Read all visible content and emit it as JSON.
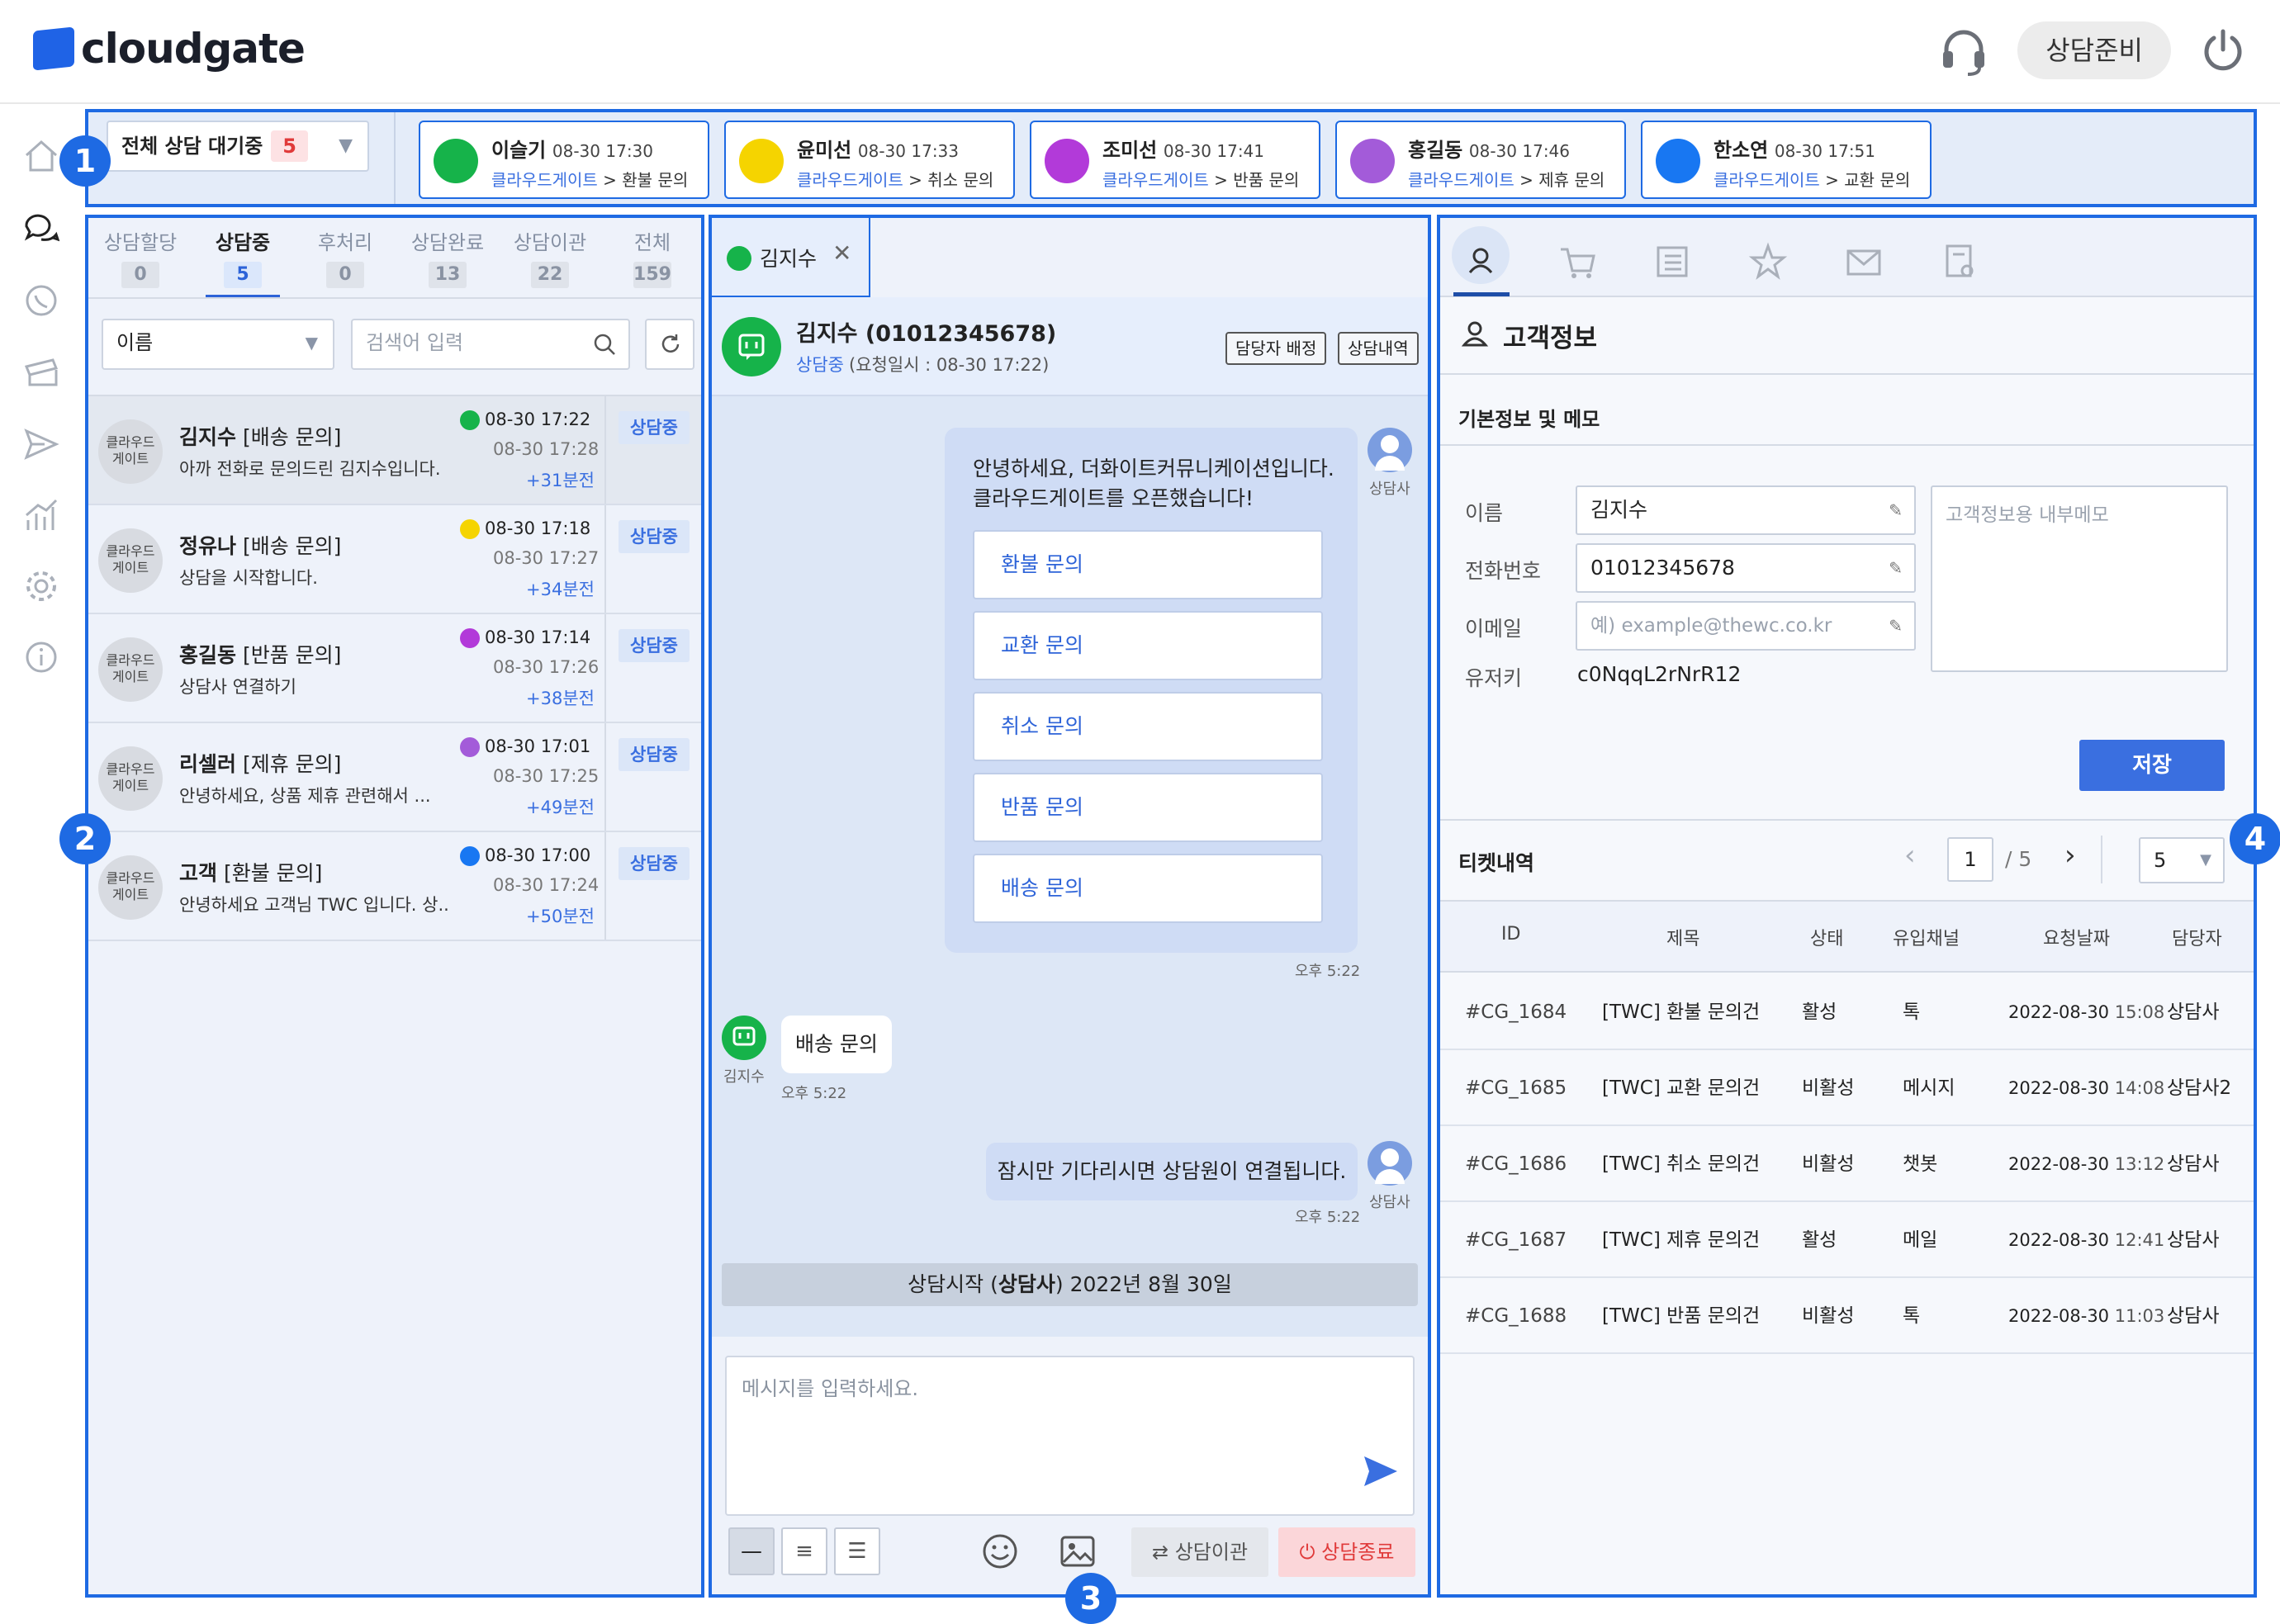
{
  "app": {
    "logo": "cloudgate",
    "status": "상담준비"
  },
  "icons": {
    "headset": "headset-icon",
    "power": "power-icon",
    "brand_color": "#1e6ae3"
  },
  "sidebar": [
    "home-icon",
    "chat-icon",
    "whatsapp-icon",
    "ticket-icon",
    "send-icon",
    "stats-icon",
    "gear-icon",
    "info-icon"
  ],
  "badges": {
    "b1": "1",
    "b2": "2",
    "b3": "3",
    "b4": "4"
  },
  "queue": {
    "filter_label": "전체 상담 대기중",
    "filter_count": "5",
    "cards": [
      {
        "name": "이슬기",
        "time": "08-30 17:30",
        "brand": "클라우드게이트",
        "topic": " > 환불 문의",
        "channel": "line",
        "color": "#16b34a"
      },
      {
        "name": "윤미선",
        "time": "08-30 17:33",
        "brand": "클라우드게이트",
        "topic": " > 취소 문의",
        "channel": "kakao",
        "color": "#f5d400"
      },
      {
        "name": "조미선",
        "time": "08-30 17:41",
        "brand": "클라우드게이트",
        "topic": " > 반품 문의",
        "channel": "bot",
        "color": "#b23ad9"
      },
      {
        "name": "홍길동",
        "time": "08-30 17:46",
        "brand": "클라우드게이트",
        "topic": " > 제휴 문의",
        "channel": "mail",
        "color": "#a35bd9"
      },
      {
        "name": "한소연",
        "time": "08-30 17:51",
        "brand": "클라우드게이트",
        "topic": " > 교환 문의",
        "channel": "messenger",
        "color": "#1877f2"
      }
    ]
  },
  "list": {
    "tabs": [
      {
        "label": "상담할당",
        "count": "0"
      },
      {
        "label": "상담중",
        "count": "5"
      },
      {
        "label": "후처리",
        "count": "0"
      },
      {
        "label": "상담완료",
        "count": "13"
      },
      {
        "label": "상담이관",
        "count": "22"
      },
      {
        "label": "전체",
        "count": "159"
      }
    ],
    "search_field": "이름",
    "search_placeholder": "검색어 입력",
    "avatar_text_1": "클라우드",
    "avatar_text_2": "게이트",
    "rows": [
      {
        "name": "김지수",
        "tag": " [배송 문의]",
        "msg": "아까 전화로 문의드린 김지수입니다.",
        "t1": "08-30 17:22",
        "t2": "08-30 17:28",
        "t3": "+31분전",
        "status": "상담중",
        "color": "#16b34a"
      },
      {
        "name": "정유나",
        "tag": " [배송 문의]",
        "msg": "상담을 시작합니다.",
        "t1": "08-30 17:18",
        "t2": "08-30 17:27",
        "t3": "+34분전",
        "status": "상담중",
        "color": "#f5d400"
      },
      {
        "name": "홍길동",
        "tag": " [반품 문의]",
        "msg": "상담사 연결하기",
        "t1": "08-30 17:14",
        "t2": "08-30 17:26",
        "t3": "+38분전",
        "status": "상담중",
        "color": "#b23ad9"
      },
      {
        "name": "리셀러",
        "tag": " [제휴 문의]",
        "msg": "안녕하세요, 상품 제휴 관련해서 ...",
        "t1": "08-30 17:01",
        "t2": "08-30 17:25",
        "t3": "+49분전",
        "status": "상담중",
        "color": "#a35bd9"
      },
      {
        "name": "고객",
        "tag": " [환불 문의]",
        "msg": "안녕하세요 고객님 TWC 입니다. 상..",
        "t1": "08-30 17:00",
        "t2": "08-30 17:24",
        "t3": "+50분전",
        "status": "상담중",
        "color": "#1877f2"
      }
    ]
  },
  "chat": {
    "tab_name": "김지수",
    "title": "김지수 (01012345678)",
    "sub_status": "상담중",
    "sub_time": " (요청일시 : 08-30 17:22)",
    "btn_assign": "담당자 배정",
    "btn_history": "상담내역",
    "greet_1": "안녕하세요, 더화이트커뮤니케이션입니다.",
    "greet_2": "클라우드게이트를 오픈했습니다!",
    "options": [
      "환불 문의",
      "교환 문의",
      "취소 문의",
      "반품 문의",
      "배송 문의"
    ],
    "agent_label": "상담사",
    "time": "오후 5:22",
    "user_msg": "배송 문의",
    "user_label": "김지수",
    "wait_msg": "잠시만 기다리시면 상담원이 연결됩니다.",
    "start_pre": "상담시작 (",
    "start_bold": "상담사",
    "start_post": ") 2022년 8월 30일",
    "input_placeholder": "메시지를 입력하세요.",
    "btn_transfer": "상담이관",
    "btn_end": "상담종료"
  },
  "customer": {
    "tab_icons": [
      "user-icon",
      "cart-icon",
      "list-icon",
      "star-icon",
      "mail-icon",
      "doc-search-icon"
    ],
    "title": "고객정보",
    "section": "기본정보 및 메모",
    "name_label": "이름",
    "name_value": "김지수",
    "phone_label": "전화번호",
    "phone_value": "01012345678",
    "email_label": "이메일",
    "email_placeholder": "예) example@thewc.co.kr",
    "userkey_label": "유저키",
    "userkey_value": "c0NqqL2rNrR12",
    "memo_placeholder": "고객정보용 내부메모",
    "save": "저장",
    "tickets_title": "티켓내역",
    "page_current": "1",
    "page_total": "/ 5",
    "page_size": "5",
    "headers": [
      "ID",
      "제목",
      "상태",
      "유입채널",
      "요청날짜",
      "담당자"
    ],
    "tickets": [
      {
        "id": "#CG_1684",
        "title": "[TWC] 환불 문의건",
        "state": "활성",
        "channel": "톡",
        "date": "2022-08-30",
        "time": " 15:08",
        "owner": "상담사"
      },
      {
        "id": "#CG_1685",
        "title": "[TWC] 교환 문의건",
        "state": "비활성",
        "channel": "메시지",
        "date": "2022-08-30",
        "time": " 14:08",
        "owner": "상담사2"
      },
      {
        "id": "#CG_1686",
        "title": "[TWC] 취소 문의건",
        "state": "비활성",
        "channel": "챗봇",
        "date": "2022-08-30",
        "time": " 13:12",
        "owner": "상담사"
      },
      {
        "id": "#CG_1687",
        "title": "[TWC] 제휴 문의건",
        "state": "활성",
        "channel": "메일",
        "date": "2022-08-30",
        "time": " 12:41",
        "owner": "상담사"
      },
      {
        "id": "#CG_1688",
        "title": "[TWC] 반품 문의건",
        "state": "비활성",
        "channel": "톡",
        "date": "2022-08-30",
        "time": " 11:03",
        "owner": "상담사"
      }
    ]
  }
}
